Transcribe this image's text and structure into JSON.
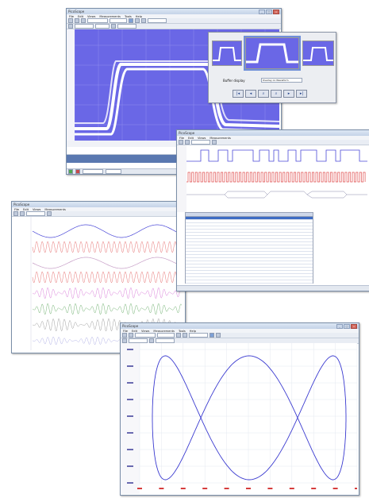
{
  "app": {
    "title": "PicoScope"
  },
  "menu": {
    "items": [
      "File",
      "Edit",
      "Views",
      "Measurements",
      "Tools",
      "Help"
    ]
  },
  "window_controls": {
    "minimize": "_",
    "maximize": "□",
    "close": "x"
  },
  "colors": {
    "scope_bg": "#6a67e6",
    "trace_white": "#ffffff",
    "trace_blue": "#4b49d8",
    "trace_red": "#e05050",
    "xy_trace": "#3a3ad0",
    "axis_red": "#d63c3c"
  },
  "persistence_panel": {
    "label": "Buffer display",
    "selected_option": "Overlay on Waveform"
  },
  "icons": [
    "zoom-in-icon",
    "zoom-out-icon",
    "pan-icon",
    "play-icon",
    "stop-icon",
    "prev-icon",
    "next-icon"
  ]
}
